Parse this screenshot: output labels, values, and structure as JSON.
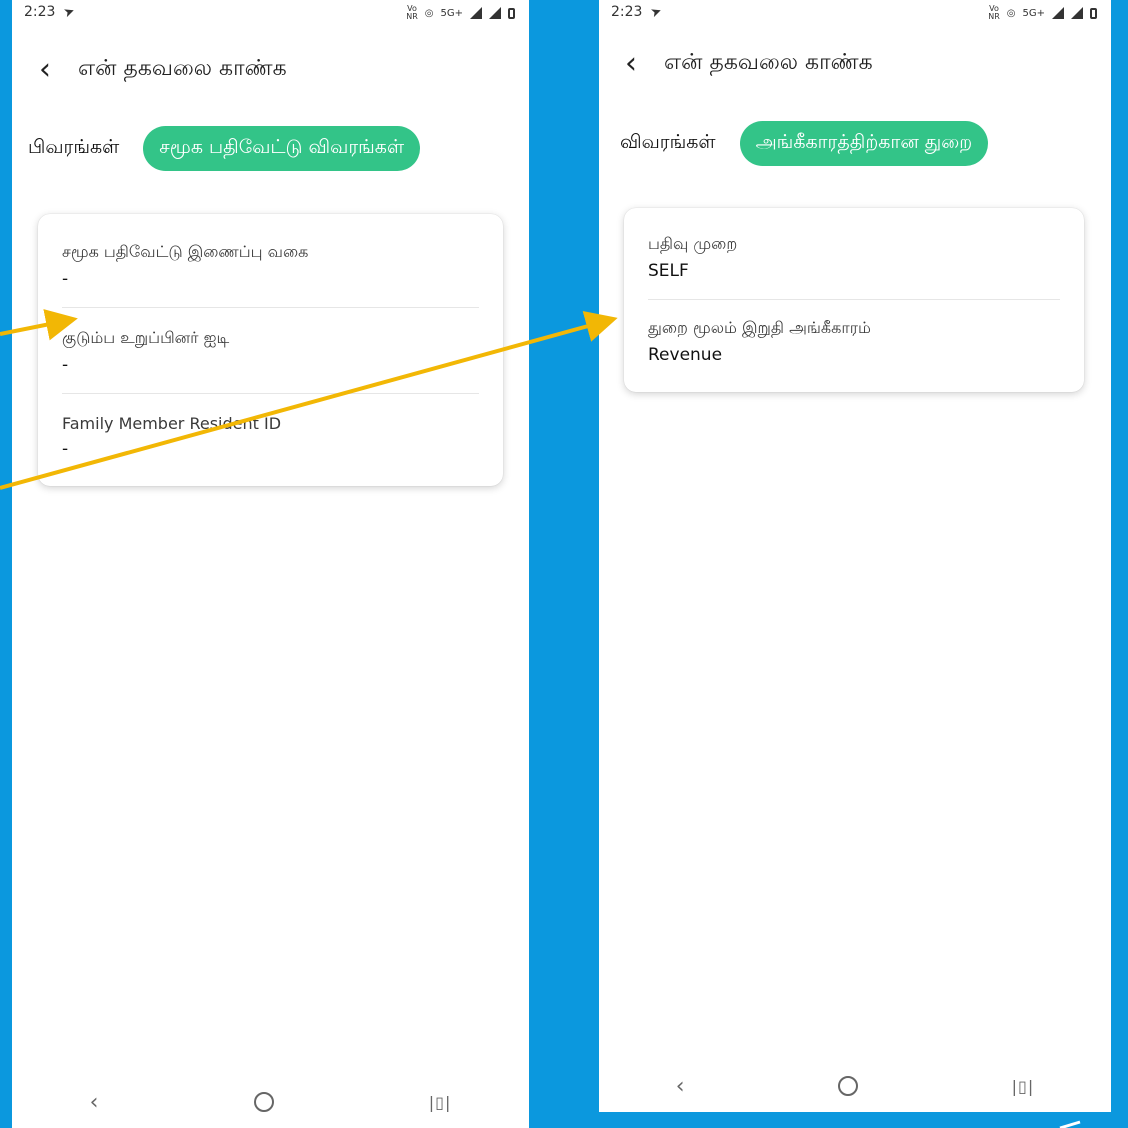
{
  "status_bar": {
    "time": "2:23",
    "network": "5G+"
  },
  "app": {
    "title": "என் தகவலை காண்க"
  },
  "left_screen": {
    "tabs": {
      "details": "பிவரங்கள்",
      "active": "சமூக பதிவேட்டு விவரங்கள்"
    },
    "fields": [
      {
        "label": "சமூக பதிவேட்டு இணைப்பு வகை",
        "value": "-"
      },
      {
        "label": "குடும்ப உறுப்பினர் ஐடி",
        "value": "-"
      },
      {
        "label": "Family Member Resident ID",
        "value": "-"
      }
    ]
  },
  "right_screen": {
    "tabs": {
      "details": "விவரங்கள்",
      "active": "அங்கீகாரத்திற்கான துறை"
    },
    "fields": [
      {
        "label": "பதிவு முறை",
        "value": "SELF"
      },
      {
        "label": "துறை மூலம் இறுதி அங்கீகாரம்",
        "value": "Revenue"
      }
    ]
  },
  "icons": {
    "telegram": "telegram-icon",
    "back": "chevron-left-icon",
    "nav_back": "nav-back-icon",
    "nav_home": "nav-home-icon",
    "nav_recent": "nav-recents-icon"
  },
  "colors": {
    "background": "#0b98de",
    "accent_tab": "#33c488",
    "arrow": "#f2b705"
  }
}
